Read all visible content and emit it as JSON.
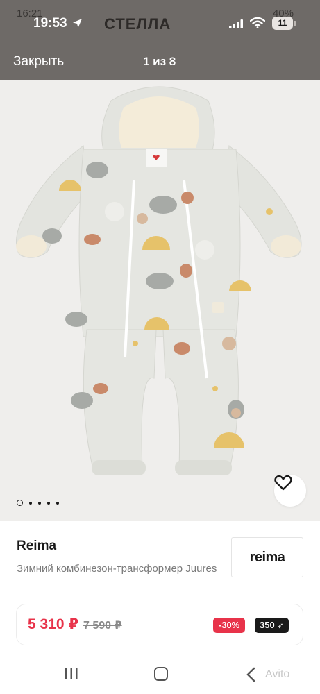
{
  "background_status": {
    "time": "16:21",
    "battery": "40%"
  },
  "background_header": {
    "title": "СТЕЛЛА"
  },
  "status_bar": {
    "time": "19:53",
    "battery": "11"
  },
  "navbar": {
    "close_label": "Закрыть",
    "counter": "1 из 8"
  },
  "gallery": {
    "total_dots": 5,
    "active_dot": 0,
    "product_tag": "reima"
  },
  "product": {
    "brand": "Reima",
    "description": "Зимний комбинезон-трансформер Juures",
    "brand_logo": "reima",
    "price": "5 310 ₽",
    "old_price": "7 590 ₽",
    "discount": "-30%",
    "bonus": "350"
  },
  "system_nav": {
    "watermark": "Avito"
  },
  "colors": {
    "accent": "#e8334a",
    "overlay": "#6e6a67",
    "dark": "#1a1a1a"
  }
}
